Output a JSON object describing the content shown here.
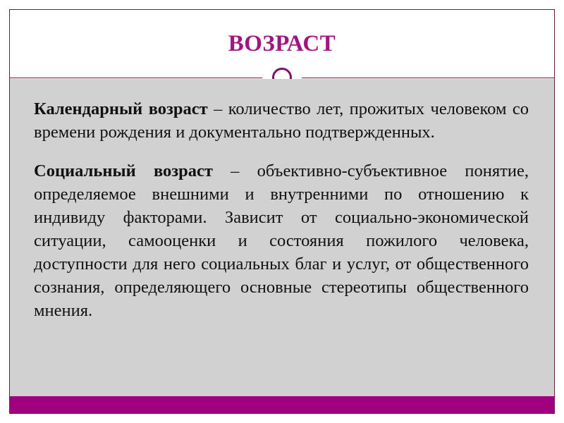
{
  "slide": {
    "title": "ВОЗРАСТ",
    "accent_color": "#A0157F",
    "frame_color": "#6E1A52",
    "body_background": "#D1D1D1",
    "footer_color": "#A0007D",
    "decorations": {
      "ring": "circle-outline",
      "divider": "horizontal-rule"
    }
  },
  "content": {
    "paragraphs": [
      {
        "lead": "Календарный возраст",
        "rest": " – количество лет, прожитых человеком со времени рождения и документально подтвержденных."
      },
      {
        "lead": "Социальный возраст",
        "rest": " – объективно-субъективное понятие, определяемое внешними и внутренними по отношению к индивиду факторами. Зависит от социально-экономической ситуации, самооценки и состояния пожилого человека, доступности для него социальных благ и услуг, от общественного сознания, определяющего основные стереотипы общественного мнения."
      }
    ]
  }
}
